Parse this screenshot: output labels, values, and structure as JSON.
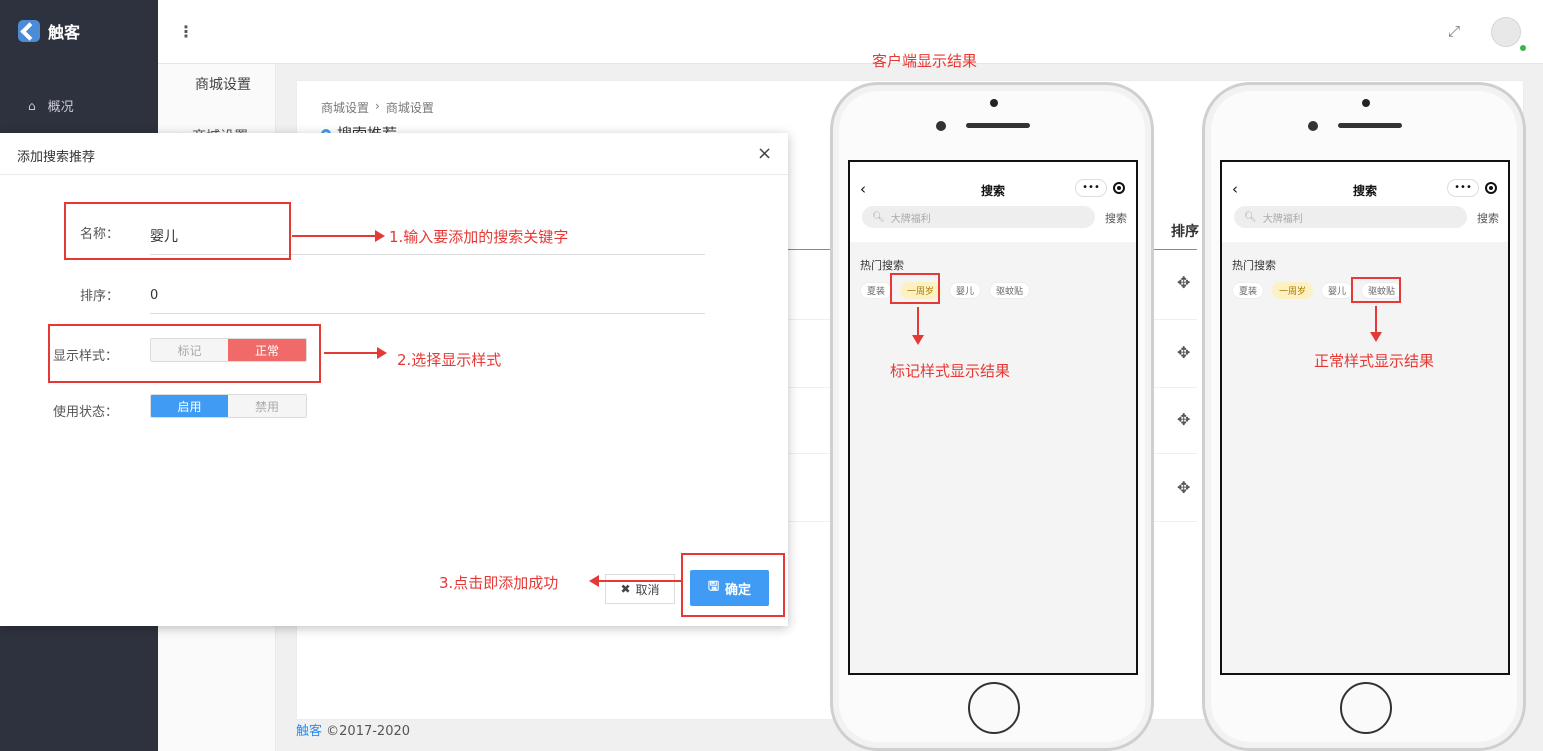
{
  "app": {
    "name": "触客"
  },
  "sidebar": {
    "items": [
      {
        "label": "概况"
      }
    ]
  },
  "subnav": {
    "title": "商城设置",
    "item": "> 商城设置"
  },
  "page": {
    "breadcrumb": [
      "商城设置",
      "›",
      "商城设置"
    ],
    "title": "搜索推荐",
    "column_sort": "排序"
  },
  "footer": {
    "brand": "触客",
    "copyright": "©2017-2020"
  },
  "modal": {
    "title": "添加搜索推荐",
    "close": "×",
    "name_label": "名称：",
    "name_value": "婴儿",
    "sort_label": "排序：",
    "sort_value": "0",
    "style_label": "显示样式：",
    "style_options": [
      "标记",
      "正常"
    ],
    "style_selected": "正常",
    "status_label": "使用状态：",
    "status_options": [
      "启用",
      "禁用"
    ],
    "status_selected": "启用",
    "cancel_label": "取消",
    "confirm_label": "确定"
  },
  "annotations": {
    "step1": "1.输入要添加的搜索关键字",
    "step2": "2.选择显示样式",
    "step3": "3.点击即添加成功",
    "client_title": "客户端显示结果",
    "mark_result": "标记样式显示结果",
    "normal_result": "正常样式显示结果"
  },
  "phone": {
    "back": "‹",
    "title": "搜索",
    "more": "•••",
    "search_placeholder": "大牌福利",
    "search_button": "搜索",
    "hot_label": "热门搜索",
    "tags": [
      "夏装",
      "一周岁",
      "婴儿",
      "驱蚊贴"
    ]
  },
  "colors": {
    "accent": "#3f9bf3",
    "danger": "#f06a6a",
    "annotation": "#e53935",
    "sidebar": "#2e323e"
  }
}
